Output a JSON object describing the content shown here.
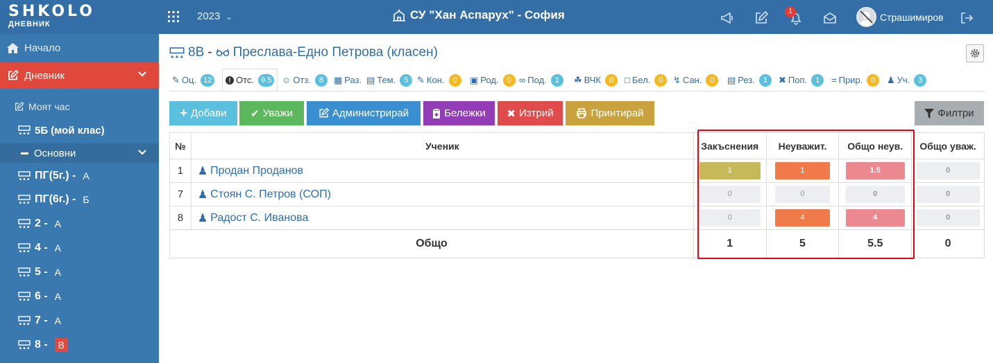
{
  "header": {
    "logo": "SHKOLO",
    "logo_sub": "ДНЕВНИК",
    "year": "2023",
    "school": "СУ \"Хан Аспарух\" - София",
    "notifications_count": "1",
    "username": "Страшимиров"
  },
  "sidebar": {
    "home": "Начало",
    "diary": "Дневник",
    "my_hour": "Моят час",
    "my_class": "5Б (мой клас)",
    "main": "Основни",
    "groups": [
      {
        "name": "ПГ(5г.) -",
        "letter": "А"
      },
      {
        "name": "ПГ(6г.) -",
        "letter": "Б"
      },
      {
        "name": "2 -",
        "letter": "А"
      },
      {
        "name": "4 -",
        "letter": "А"
      },
      {
        "name": "5 -",
        "letter": "А"
      },
      {
        "name": "6 -",
        "letter": "А"
      },
      {
        "name": "7 -",
        "letter": "А"
      },
      {
        "name": "8 -",
        "letter": "В"
      }
    ]
  },
  "page": {
    "class_name": "8В",
    "separator": "-",
    "teacher": "Преслава-Едно Петрова (класен)"
  },
  "tabs": [
    {
      "label": "Оц.",
      "badge": "12"
    },
    {
      "label": "Отс.",
      "badge": "9.5"
    },
    {
      "label": "Отз.",
      "badge": "8"
    },
    {
      "label": "Раз.",
      "badge": ""
    },
    {
      "label": "Тем.",
      "badge": "5"
    },
    {
      "label": "Кон.",
      "badge": "0"
    },
    {
      "label": "Род.",
      "badge": "0"
    },
    {
      "label": "Под.",
      "badge": "1"
    },
    {
      "label": "ВЧК",
      "badge": "0"
    },
    {
      "label": "Бел.",
      "badge": "0"
    },
    {
      "label": "Сан.",
      "badge": "0"
    },
    {
      "label": "Рез.",
      "badge": "1"
    },
    {
      "label": "Поп.",
      "badge": "1"
    },
    {
      "label": "Прир.",
      "badge": "0"
    },
    {
      "label": "Уч.",
      "badge": "3"
    }
  ],
  "toolbar": {
    "add": "Добави",
    "excuse": "Уважи",
    "admin": "Администрирай",
    "notes": "Бележки",
    "delete": "Изтрий",
    "print": "Принтирай",
    "filters": "Филтри"
  },
  "table": {
    "headers": [
      "№",
      "Ученик",
      "Закъснения",
      "Неуважит.",
      "Общо неув.",
      "Общо уваж."
    ],
    "rows": [
      {
        "no": "1",
        "name": "Продан Проданов",
        "late": "1",
        "unexcused": "1",
        "total_unexcused": "1.5",
        "total_excused": "0"
      },
      {
        "no": "7",
        "name": "Стоян С. Петров (СОП)",
        "late": "0",
        "unexcused": "0",
        "total_unexcused": "0",
        "total_excused": "0"
      },
      {
        "no": "8",
        "name": "Радост С. Иванова",
        "late": "0",
        "unexcused": "4",
        "total_unexcused": "4",
        "total_excused": "0"
      }
    ],
    "total": {
      "label": "Общо",
      "late": "1",
      "unexcused": "5",
      "total_unexcused": "5.5",
      "total_excused": "0"
    }
  },
  "colors": {
    "topbar": "#336fa6",
    "sidebar": "#3a78b0",
    "diary_active": "#e0483c",
    "late_cell": "#c5b95a",
    "unexcused_cell": "#f07a4a",
    "total_unexcused_cell": "#ec8990",
    "highlight_border": "#e0001a"
  }
}
